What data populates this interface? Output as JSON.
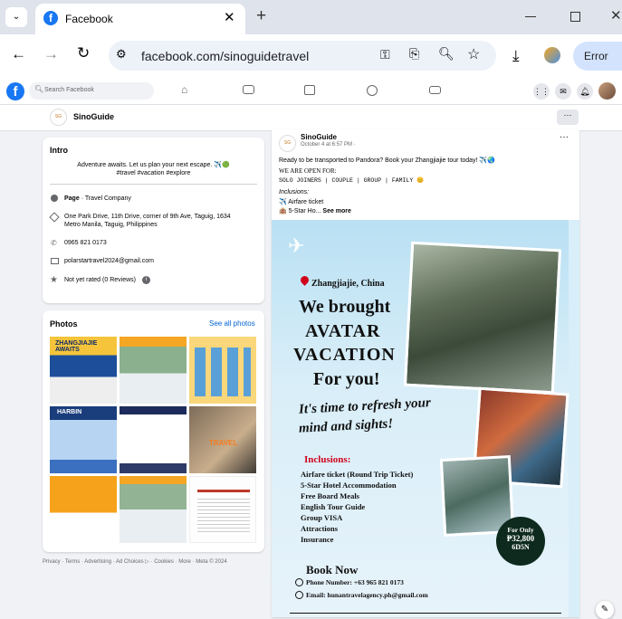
{
  "browser": {
    "tab_title": "Facebook",
    "url": "facebook.com/sinoguidetravel",
    "error_label": "Error"
  },
  "fb": {
    "search_placeholder": "Search Facebook"
  },
  "page": {
    "name": "SinoGuide"
  },
  "intro": {
    "title": "Intro",
    "bio_line1": "Adventure awaits. Let us plan your next escape. ✈️🟢",
    "bio_line2": "#travel #vacation #explore",
    "page_label": "Page",
    "category": "· Travel Company",
    "address_line1": "One Park Drive, 11th Drive, corner of 9th Ave, Taguig, 1634",
    "address_line2": "Metro Manila, Taguig, Philippines",
    "phone": "0965 821 0173",
    "email": "polarstartravel2024@gmail.com",
    "rating": "Not yet rated (0 Reviews)"
  },
  "photos": {
    "title": "Photos",
    "see_all": "See all photos"
  },
  "footer": {
    "text": "Privacy · Terms · Advertising · Ad Choices ▷ · Cookies · More · Meta © 2024"
  },
  "post": {
    "author": "SinoGuide",
    "meta": "October 4 at 6:57 PM ·",
    "line1": "Ready to be transported to Pandora? Book your Zhangjiajie tour today! ✈️🌏",
    "open": "WE ARE OPEN FOR:",
    "open_types": "SOLO JOINERS | COUPLE | GROUP | FAMILY 😊",
    "inclusions_label": "Inclusions:",
    "incl1": "✈️ Airfare ticket",
    "incl2": "🏨 5-Star Ho...",
    "see_more": "See more"
  },
  "poster": {
    "location": "Zhangjiajie, China",
    "headline1": "We brought",
    "headline2": "AVATAR",
    "headline3": "VACATION",
    "headline4": "For you!",
    "tagline1": "It's time to refresh your",
    "tagline2": "mind and sights!",
    "inclusions_title": "Inclusions:",
    "items": [
      "Airfare ticket (Round Trip Ticket)",
      "5-Star Hotel Accommodation",
      "Free Board Meals",
      "English Tour Guide",
      "Group VISA",
      "Attractions",
      "Insurance"
    ],
    "price_label": "For Only",
    "price": "₱32,800",
    "duration": "6D5N",
    "book_now": "Book Now",
    "phone": "Phone Number: +63 965 821 0173",
    "email": "Email: hunantravelagency.ph@gmail.com"
  },
  "photo_tiles": [
    {
      "label": "ZHANGJIAJIE AWAITS"
    },
    {
      "label": ""
    },
    {
      "label": ""
    },
    {
      "label": "HARBIN"
    },
    {
      "label": ""
    },
    {
      "label": "TRAVEL"
    },
    {
      "label": ""
    },
    {
      "label": ""
    },
    {
      "label": ""
    }
  ]
}
